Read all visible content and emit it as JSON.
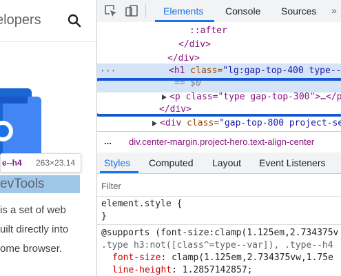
{
  "page": {
    "site_title": "elopers",
    "tooltip_selector": "e--h4",
    "tooltip_dims": "263×23.14",
    "heading": "evTools",
    "description_lines": [
      "is a set of web",
      "uilt directly into",
      "ome browser."
    ]
  },
  "devtools": {
    "tabs": [
      {
        "label": "Elements",
        "active": true
      },
      {
        "label": "Console",
        "active": false
      },
      {
        "label": "Sources",
        "active": false
      }
    ],
    "more_tabs": "»",
    "dom": {
      "line_after": "::after",
      "line_close_div_1": "</div>",
      "line_close_div_2": "</div>",
      "h1_tag_open": "<h1",
      "h1_attr_name": " class=",
      "h1_attr_value": "\"lg:gap-top-400 type--",
      "h1_eq": "== $0",
      "p_line": "<p class=\"type gap-top-300\">…</p>",
      "close_div_3": "</div>",
      "div_tag": "<div",
      "div_attr": " class=",
      "div_val": "\"gap-top-800 project-se",
      "dots": "···"
    },
    "breadcrumb": {
      "more": "...",
      "path": "div.center-margin.project-hero.text-align-center"
    },
    "styles_tabs": [
      {
        "label": "Styles",
        "active": true
      },
      {
        "label": "Computed",
        "active": false
      },
      {
        "label": "Layout",
        "active": false
      },
      {
        "label": "Event Listeners",
        "active": false
      }
    ],
    "filter_placeholder": "Filter",
    "css": {
      "element_style": "element.style {",
      "close_brace": "}",
      "supports": "@supports (font-size:clamp(1.125em,2.734375v",
      "selector": ".type h3:not([class^=type--var]), .type--h4",
      "prop1_name": "font-size",
      "prop1_value": ": clamp(1.125em,2.734375vw,1.75e",
      "prop2_name": "line-height",
      "prop2_value": ": 1.2857142857;"
    }
  },
  "colors": {
    "accent": "#1a73e8",
    "selection_outline": "#1558d6",
    "selected_row": "#d5e5f7"
  }
}
